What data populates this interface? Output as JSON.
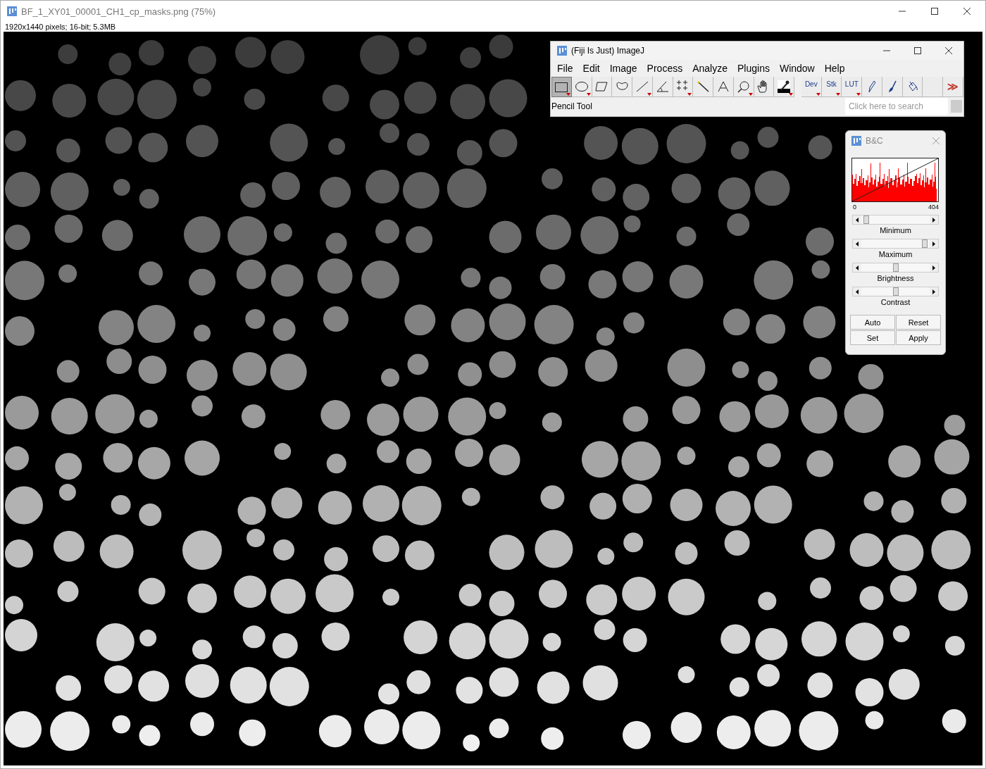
{
  "image_window": {
    "title": "BF_1_XY01_00001_CH1_cp_masks.png (75%)",
    "info": "1920x1440 pixels; 16-bit; 5.3MB"
  },
  "imagej": {
    "title": "(Fiji Is Just) ImageJ",
    "menu": [
      "File",
      "Edit",
      "Image",
      "Process",
      "Analyze",
      "Plugins",
      "Window",
      "Help"
    ],
    "tools": [
      {
        "kind": "rect",
        "selected": true,
        "menu": true
      },
      {
        "kind": "oval",
        "selected": false,
        "menu": true
      },
      {
        "kind": "polygon",
        "selected": false,
        "menu": false
      },
      {
        "kind": "freehand",
        "selected": false,
        "menu": false
      },
      {
        "kind": "line",
        "selected": false,
        "menu": true
      },
      {
        "kind": "angle",
        "selected": false,
        "menu": false
      },
      {
        "kind": "point",
        "selected": false,
        "menu": true
      },
      {
        "kind": "wand",
        "selected": false,
        "menu": false
      },
      {
        "kind": "text",
        "selected": false,
        "menu": false
      },
      {
        "kind": "zoom",
        "selected": false,
        "menu": true
      },
      {
        "kind": "hand",
        "selected": false,
        "menu": false
      },
      {
        "kind": "dropper",
        "selected": false,
        "menu": true
      },
      {
        "kind": "gap"
      },
      {
        "kind": "label",
        "label": "Dev",
        "selected": false,
        "menu": true
      },
      {
        "kind": "label",
        "label": "Stk",
        "selected": false,
        "menu": true
      },
      {
        "kind": "label",
        "label": "LUT",
        "selected": false,
        "menu": true
      },
      {
        "kind": "pencil",
        "selected": false,
        "menu": false
      },
      {
        "kind": "brush",
        "selected": false,
        "menu": false
      },
      {
        "kind": "bucket",
        "selected": false,
        "menu": false
      },
      {
        "kind": "blank",
        "selected": false,
        "menu": false
      },
      {
        "kind": "more",
        "label": "≫",
        "selected": false,
        "menu": false
      }
    ],
    "status": "Pencil Tool",
    "search": {
      "placeholder": "Click here to search"
    }
  },
  "bc": {
    "title": "B&C",
    "range_min": "0",
    "range_max": "404",
    "sliders": [
      {
        "label": "Minimum",
        "level": 0.03
      },
      {
        "label": "Maximum",
        "level": 0.97
      },
      {
        "label": "Brightness",
        "level": 0.5
      },
      {
        "label": "Contrast",
        "level": 0.5
      }
    ],
    "buttons": [
      "Auto",
      "Reset",
      "Set",
      "Apply"
    ]
  }
}
